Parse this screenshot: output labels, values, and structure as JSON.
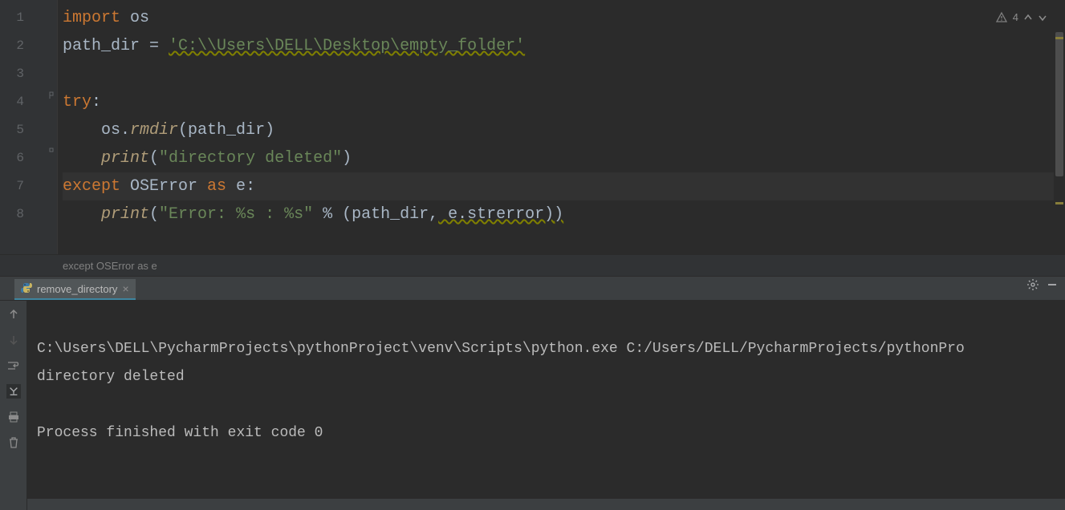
{
  "editor": {
    "lines": [
      "1",
      "2",
      "3",
      "4",
      "5",
      "6",
      "7",
      "8"
    ],
    "current_line_index": 6,
    "code": {
      "l1_kw": "import",
      "l1_mod": " os",
      "l2_ident": "path_dir ",
      "l2_eq": "= ",
      "l2_str": "'C:\\\\Users\\DELL\\Desktop\\empty_folder'",
      "l4_kw": "try",
      "l4_colon": ":",
      "l5_indent": "    ",
      "l5_obj": "os.",
      "l5_func": "rmdir",
      "l5_args": "(path_dir)",
      "l6_indent": "    ",
      "l6_func": "print",
      "l6_popen": "(",
      "l6_str": "\"directory deleted\"",
      "l6_pclose": ")",
      "l7_kw1": "except ",
      "l7_cls": "OSError ",
      "l7_kw2": "as ",
      "l7_var": "e",
      "l7_colon": ":",
      "l8_indent": "    ",
      "l8_func": "print",
      "l8_popen": "(",
      "l8_str": "\"Error: %s : %s\"",
      "l8_mid": " % (path_dir",
      "l8_comma": ",",
      "l8_rest": " e.strerror)",
      "l8_pclose": ")"
    },
    "inspection_count": "4"
  },
  "breadcrumb": "except OSError as e",
  "run_tab": {
    "label": "remove_directory"
  },
  "console": {
    "line1": "C:\\Users\\DELL\\PycharmProjects\\pythonProject\\venv\\Scripts\\python.exe C:/Users/DELL/PycharmProjects/pythonPro",
    "line2": "directory deleted",
    "line3": "",
    "line4": "Process finished with exit code 0"
  }
}
